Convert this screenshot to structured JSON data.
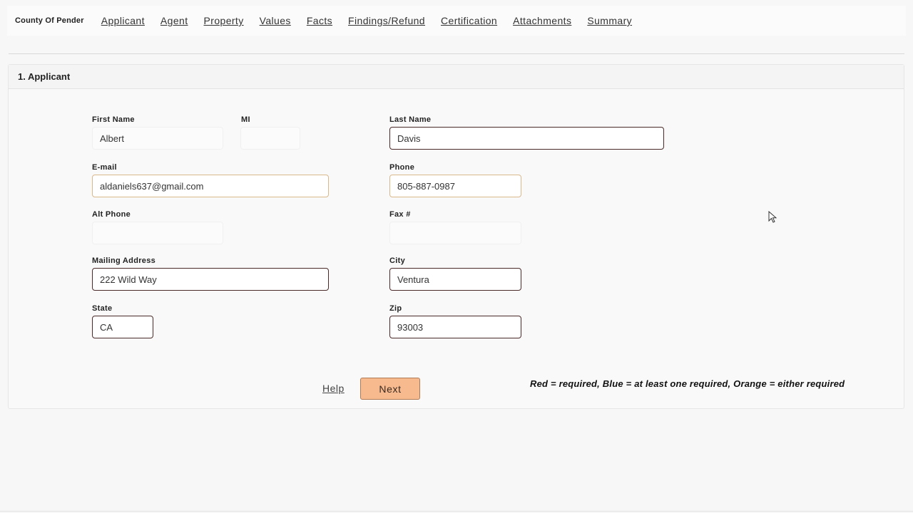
{
  "nav": {
    "county": "County Of Pender",
    "links": [
      "Applicant",
      "Agent",
      "Property",
      "Values",
      "Facts",
      "Findings/Refund",
      "Certification",
      "Attachments",
      "Summary"
    ]
  },
  "section": {
    "title": "1. Applicant"
  },
  "form": {
    "first_name": {
      "label": "First Name",
      "value": "Albert"
    },
    "mi": {
      "label": "MI",
      "value": ""
    },
    "last_name": {
      "label": "Last Name",
      "value": "Davis"
    },
    "email": {
      "label": "E-mail",
      "value": "aldaniels637@gmail.com"
    },
    "phone": {
      "label": "Phone",
      "value": "805-887-0987"
    },
    "alt_phone": {
      "label": "Alt Phone",
      "value": ""
    },
    "fax": {
      "label": "Fax #",
      "value": ""
    },
    "mailing_address": {
      "label": "Mailing Address",
      "value": "222 Wild Way"
    },
    "city": {
      "label": "City",
      "value": "Ventura"
    },
    "state": {
      "label": "State",
      "value": "CA"
    },
    "zip": {
      "label": "Zip",
      "value": "93003"
    }
  },
  "actions": {
    "help": "Help",
    "next": "Next"
  },
  "legend": "Red = required, Blue = at least one required, Orange = either required",
  "colors": {
    "next_button": "#f7b98e",
    "required_border": "#4a2a28",
    "either_border": "#d9b88a"
  }
}
